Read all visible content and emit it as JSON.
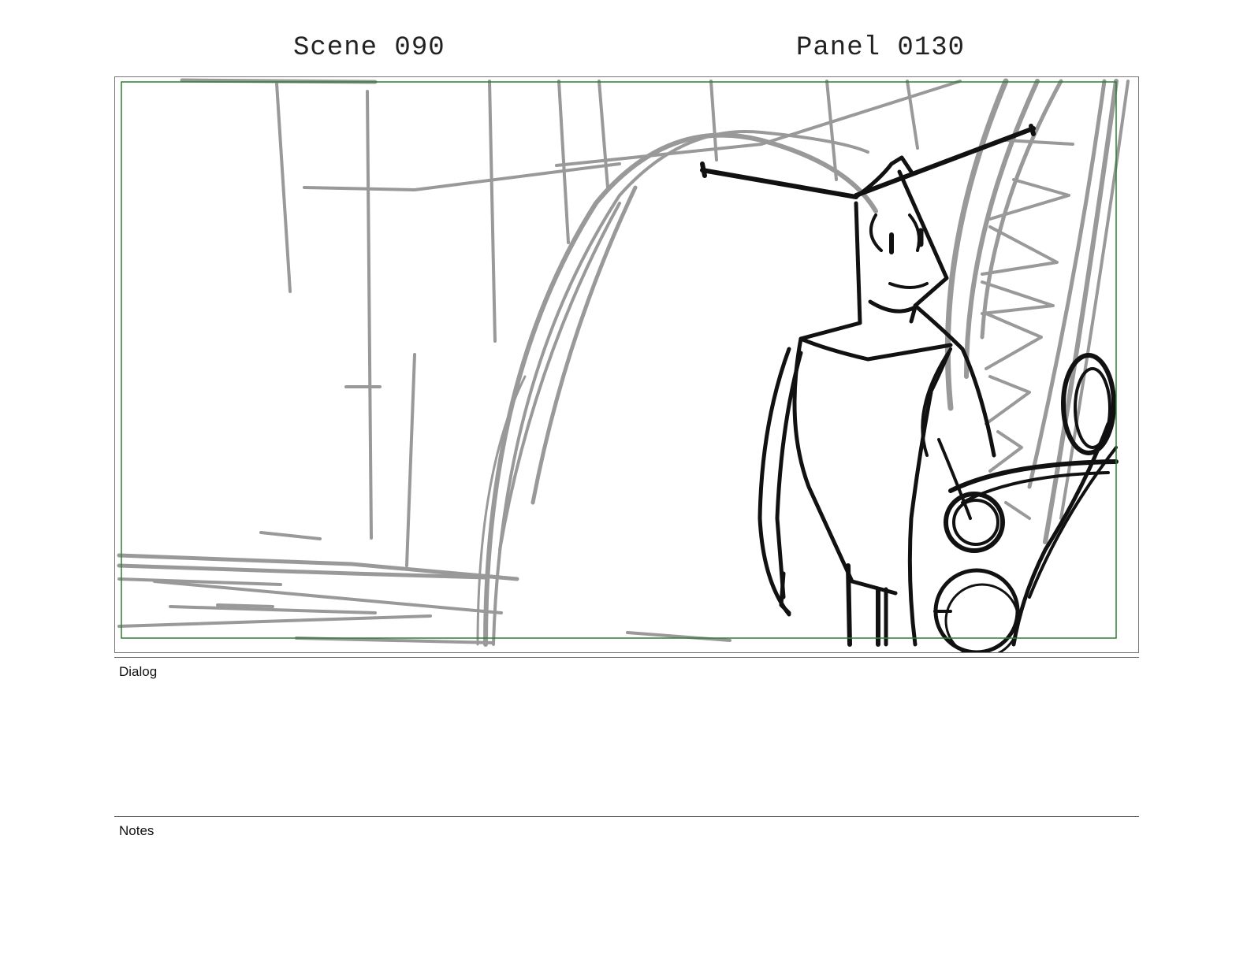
{
  "header": {
    "scene": "Scene 090",
    "panel": "Panel 0130"
  },
  "sections": {
    "dialog_label": "Dialog",
    "dialog_text": "",
    "notes_label": "Notes",
    "notes_text": ""
  },
  "colors": {
    "safe_frame": "#2e7d32",
    "background_sketch": "#999999",
    "character_ink": "#111111"
  }
}
